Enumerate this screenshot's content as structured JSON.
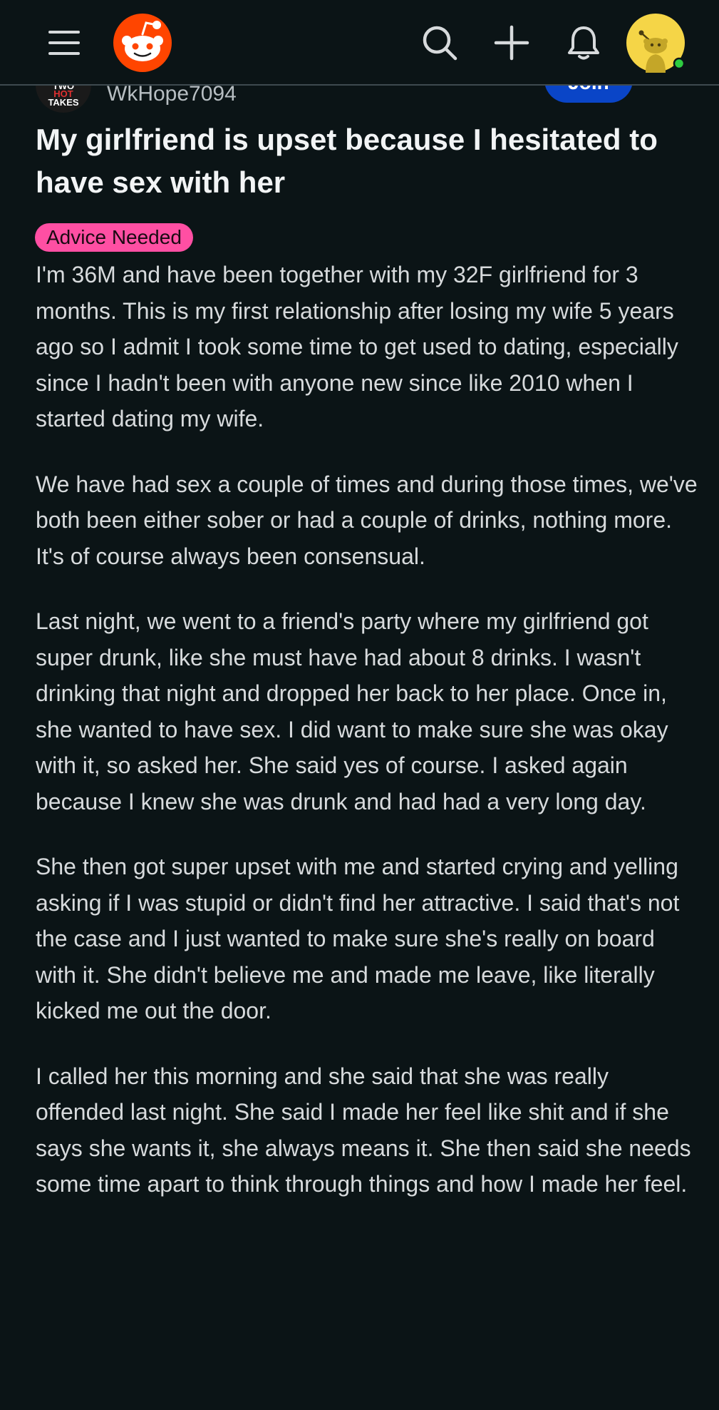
{
  "nav": {
    "menu_icon": "hamburger-menu-icon",
    "logo_icon": "reddit-logo-icon",
    "search_icon": "search-icon",
    "create_icon": "plus-icon",
    "notifications_icon": "bell-icon",
    "avatar_icon": "snoo-avatar-icon",
    "online_status_color": "#2ecc40"
  },
  "post": {
    "community_avatar": {
      "line1": "TWO",
      "line2": "HOT",
      "line3": "TAKES"
    },
    "username": "WkHope7094",
    "join_label": "Join",
    "title": "My girlfriend is upset because I hesitated to have sex with her",
    "flair": "Advice Needed",
    "flair_color": "#ff4fa3",
    "body": [
      "I'm 36M and have been together with my 32F girlfriend for 3 months. This is my first relationship after losing my wife 5 years ago so I admit I took some time to get used to dating, especially since I hadn't been with anyone new since like 2010 when I started dating my wife.",
      "We have had sex a couple of times and during those times, we've both been either sober or had a couple of drinks, nothing more. It's of course always been consensual.",
      "Last night, we went to a friend's party where my girlfriend got super drunk, like she must have had about 8 drinks. I wasn't drinking that night and dropped her back to her place. Once in, she wanted to have sex. I did want to make sure she was okay with it, so asked her. She said yes of course. I asked again because I knew she was drunk and had had a very long day.",
      "She then got super upset with me and started crying and yelling asking if I was stupid or didn't find her attractive. I said that's not the case and I just wanted to make sure she's really on board with it. She didn't believe me and made me leave, like literally kicked me out the door.",
      "I called her this morning and she said that she was really offended last night. She said I made her feel like shit and if she says she wants it, she always means it. She then said she needs some time apart to think through things and how I made her feel."
    ]
  },
  "colors": {
    "background": "#0b1416",
    "join_button": "#0a45c7",
    "logo": "#ff4500",
    "avatar_bg": "#f5d547"
  }
}
